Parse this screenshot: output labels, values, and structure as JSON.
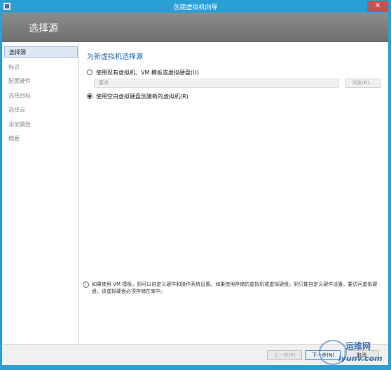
{
  "window": {
    "title": "创建虚拟机向导",
    "close_glyph": "✕"
  },
  "header": {
    "title": "选择源"
  },
  "sidebar": {
    "items": [
      {
        "label": "选择源",
        "active": true
      },
      {
        "label": "标识",
        "active": false
      },
      {
        "label": "配置硬件",
        "active": false
      },
      {
        "label": "选择目标",
        "active": false
      },
      {
        "label": "选择云",
        "active": false
      },
      {
        "label": "添加属性",
        "active": false
      },
      {
        "label": "摘要",
        "active": false
      }
    ]
  },
  "main": {
    "section_title": "为新虚拟机选择源",
    "option_existing": {
      "label": "使用现有虚拟机、VM 模板或虚拟硬盘(U)",
      "checked": false
    },
    "source_field": {
      "placeholder": "要求",
      "value": ""
    },
    "browse_label": "浏览(B)...",
    "option_blank": {
      "label": "使用空白虚拟硬盘创建新的虚拟机(R)",
      "checked": true
    }
  },
  "info": {
    "icon": "info-icon",
    "text": "如果使用 VM 模板，则可以自定义硬件和操作系统设置。如果使用存储的虚拟机或虚拟硬盘，则只能自定义硬件设置。要访问虚拟硬盘，该虚拟硬盘必须存储在库中。"
  },
  "footer": {
    "prev_label": "上一步(P)",
    "next_label": "下一步(N)",
    "cancel_label": "取消"
  },
  "watermark": {
    "line1": "运维网",
    "line2": "iyunv.com"
  },
  "colors": {
    "titlebar": "#2a9fd6",
    "accent": "#1d64a8",
    "header": "#7d7d7d"
  }
}
